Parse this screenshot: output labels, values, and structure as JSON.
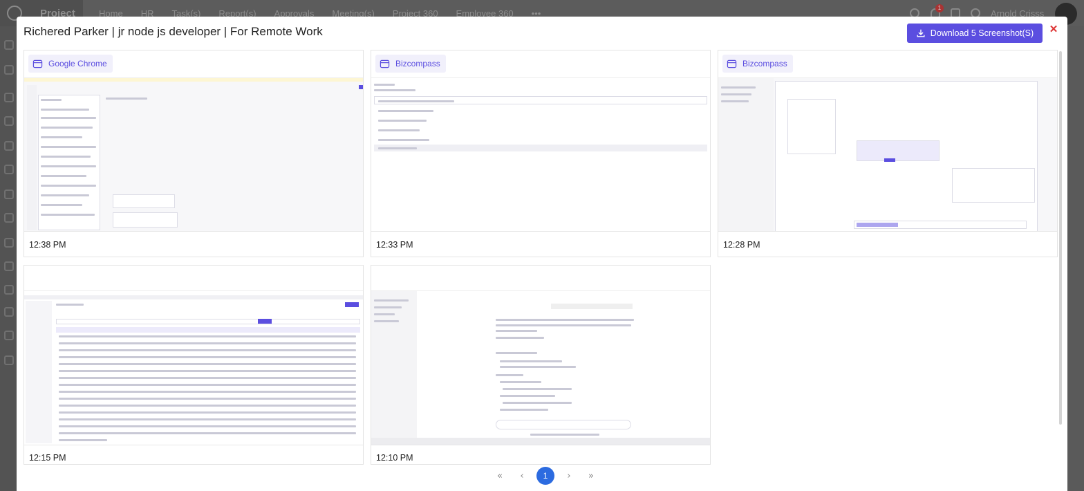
{
  "background_app": {
    "brand": "Project",
    "nav": [
      "Home",
      "HR",
      "Task(s)",
      "Report(s)",
      "Approvals",
      "Meeting(s)",
      "Project 360",
      "Employee 360"
    ],
    "more": "•••",
    "notification_count": "1",
    "user_name": "Arnold Crisss"
  },
  "modal": {
    "title": "Richered Parker | jr node js developer | For Remote Work",
    "download_label": "Download 5 Screenshot(S)",
    "close_label": "✕"
  },
  "screenshots": [
    {
      "app": "Google Chrome",
      "time": "12:38 PM"
    },
    {
      "app": "Bizcompass",
      "time": "12:33 PM"
    },
    {
      "app": "Bizcompass",
      "time": "12:28 PM"
    },
    {
      "app": "",
      "time": "12:15 PM"
    },
    {
      "app": "",
      "time": "12:10 PM"
    }
  ],
  "pagination": {
    "first": "«",
    "prev": "‹",
    "current": "1",
    "next": "›",
    "last": "»"
  },
  "colors": {
    "accent": "#5b4ee0",
    "close": "#dd3333",
    "page_active": "#2c6be0"
  }
}
